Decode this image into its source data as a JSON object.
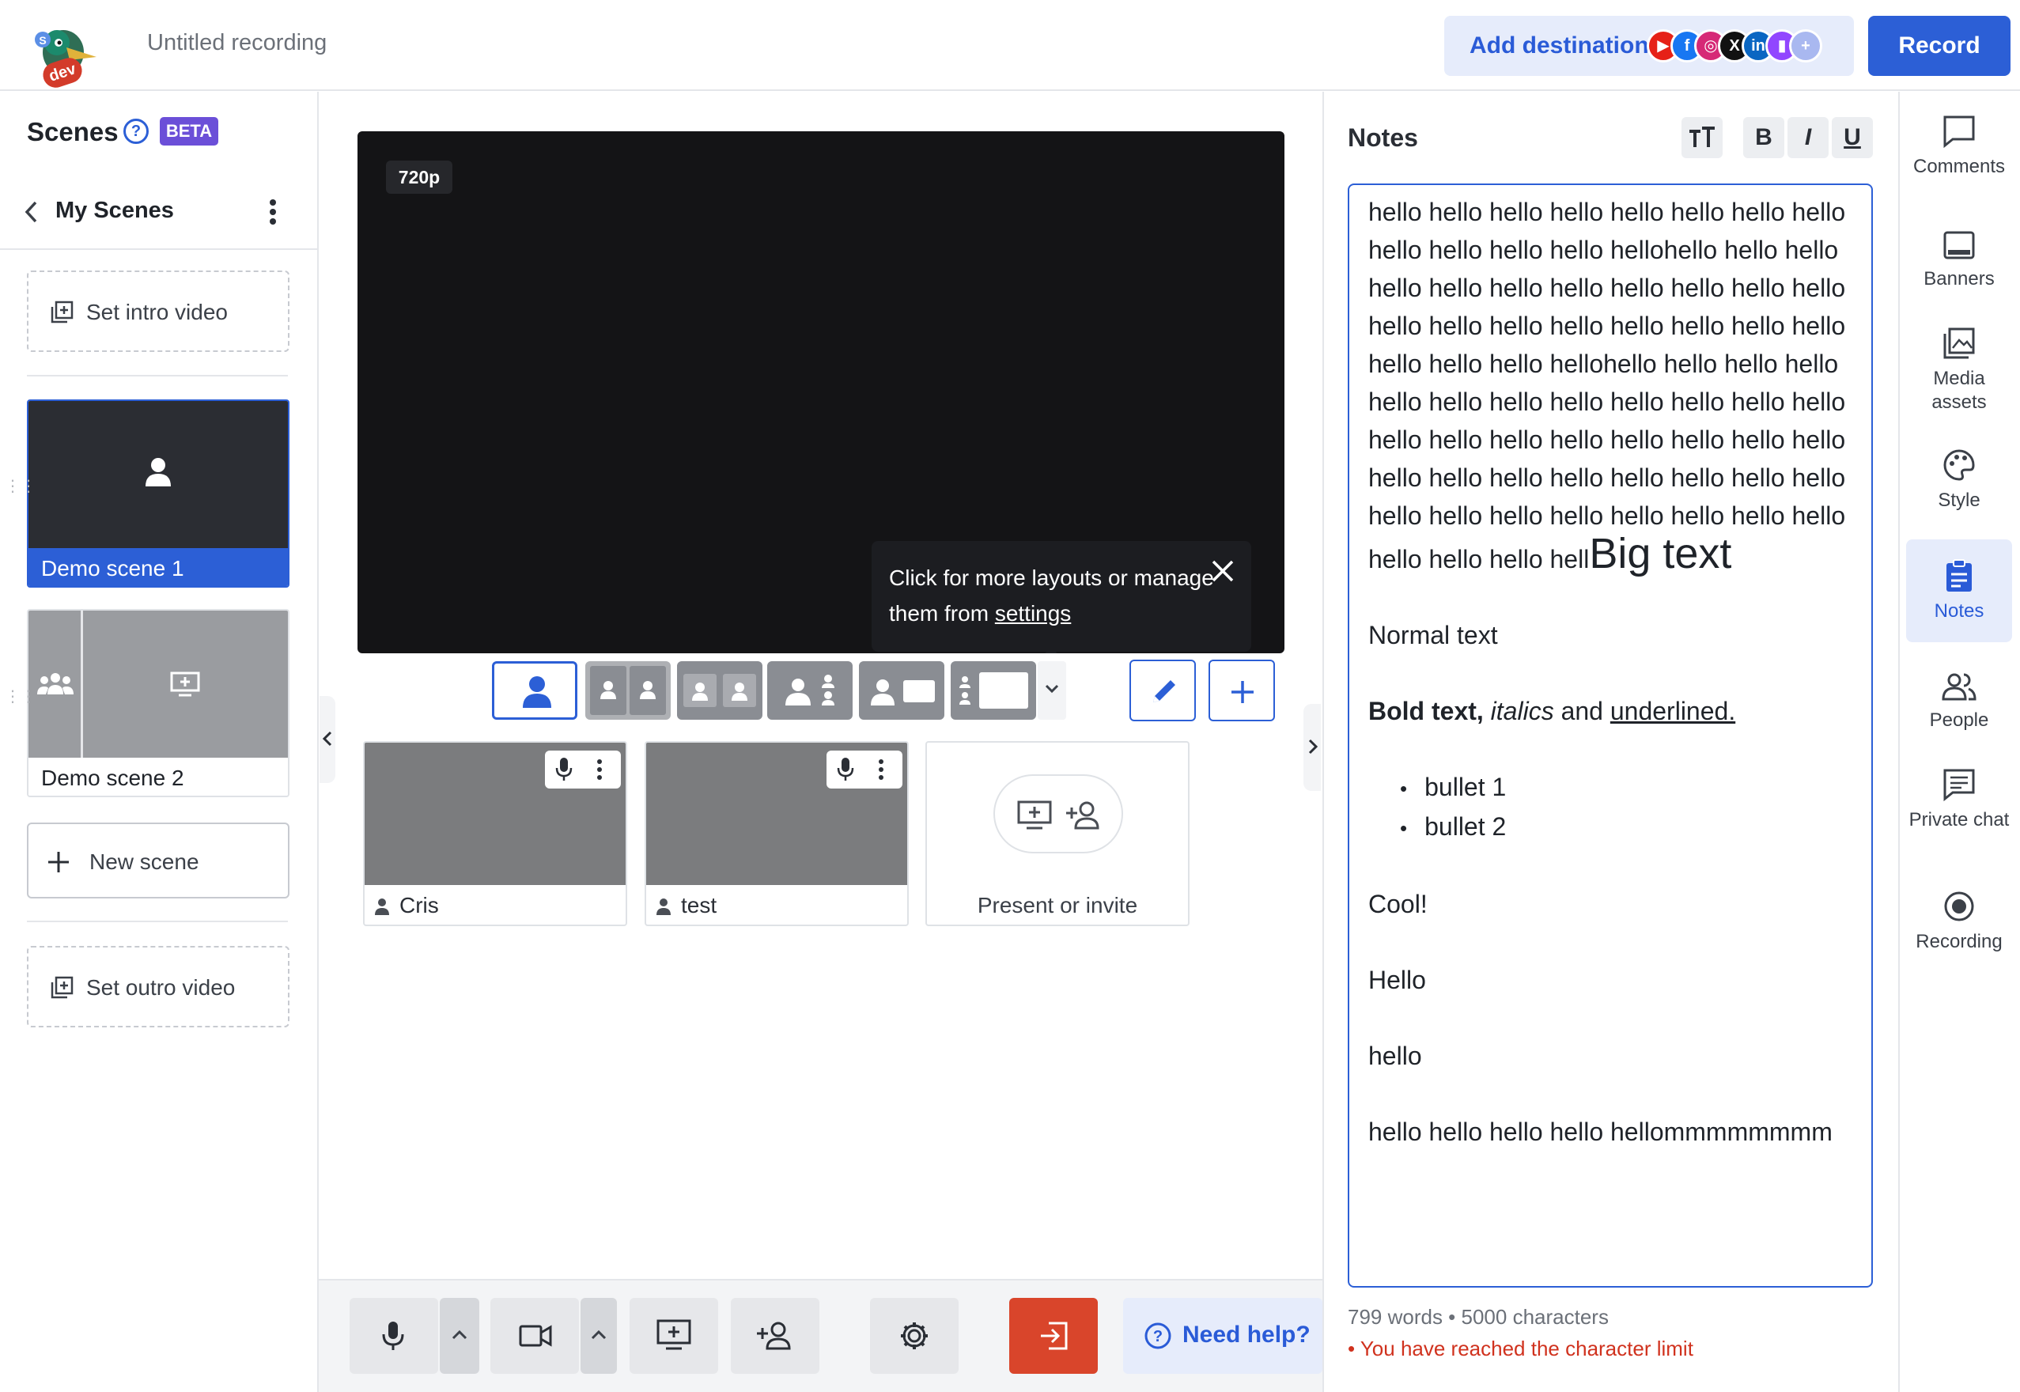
{
  "header": {
    "logo_badge": "dev",
    "recording_title": "Untitled recording",
    "add_destination_label": "Add destination",
    "destinations": [
      "youtube-icon",
      "facebook-icon",
      "instagram-icon",
      "x-icon",
      "linkedin-icon",
      "twitch-icon",
      "plus-icon"
    ],
    "record_label": "Record"
  },
  "scenes": {
    "title": "Scenes",
    "badge": "BETA",
    "folder": "My Scenes",
    "intro_label": "Set intro video",
    "outro_label": "Set outro video",
    "items": [
      {
        "label": "Demo scene 1",
        "active": true
      },
      {
        "label": "Demo scene 2",
        "active": false
      }
    ],
    "new_scene_label": "New scene"
  },
  "stage": {
    "resolution": "720p",
    "tooltip_text": "Click for more layouts or manage them from ",
    "tooltip_link": "settings"
  },
  "participants": [
    {
      "name": "Cris"
    },
    {
      "name": "test"
    }
  ],
  "present_invite_label": "Present or invite",
  "bottom": {
    "help_label": "Need help?"
  },
  "notes": {
    "title": "Notes",
    "format_bold": "B",
    "format_italic": "I",
    "format_underline": "U",
    "content": {
      "para1": "hello hello hello hello hello hello hello hello hello hello hello hello hellohello hello hello hello hello hello hello hello hello hello hello hello hello hello hello hello hello hello hello hello hello hello hellohello hello hello hello hello hello hello hello hello hello hello hello hello hello hello hello hello hello hello hello hello hello hello hello hello hello hello hello hello hello hello hello hello hello hello hello hello hello hello hell",
      "big_text": "Big text",
      "normal_text": "Normal text",
      "bold_text": "Bold text,",
      "italic_text": "italics",
      "and_text": " and ",
      "underlined_text": "underlined.",
      "bullets": [
        "bullet 1",
        "bullet 2"
      ],
      "cool": "Cool!",
      "hello_cap": "Hello",
      "hello_lower": "hello",
      "last_para": "hello hello hello hello hellommmmmmmm"
    },
    "stats": "799 words • 5000 characters",
    "limit_warning": "• You have reached the character limit"
  },
  "rail": {
    "items": [
      {
        "label": "Comments",
        "icon": "comment-icon"
      },
      {
        "label": "Banners",
        "icon": "banner-icon"
      },
      {
        "label": "Media assets",
        "icon": "media-icon"
      },
      {
        "label": "Style",
        "icon": "palette-icon"
      },
      {
        "label": "Notes",
        "icon": "notes-icon",
        "active": true
      },
      {
        "label": "People",
        "icon": "people-icon"
      },
      {
        "label": "Private chat",
        "icon": "chat-icon"
      },
      {
        "label": "Recording",
        "icon": "record-icon"
      }
    ]
  },
  "colors": {
    "accent": "#2c5fd6",
    "beta_badge": "#6b4fd8",
    "exit_button": "#d9452b",
    "warning": "#d0321e"
  }
}
